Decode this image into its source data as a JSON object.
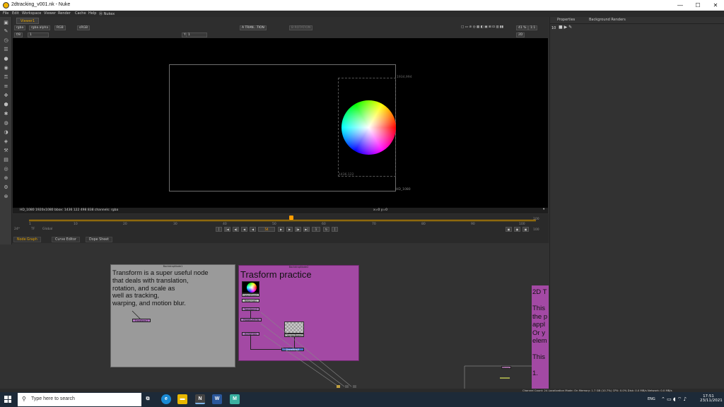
{
  "window": {
    "title": "2dtracking_v001.nk - Nuke",
    "min": "—",
    "max": "☐",
    "close": "✕"
  },
  "menu": [
    "File",
    "Edit",
    "Workspace",
    "Viewer",
    "Render",
    "Cache",
    "Help",
    "Ⓝ Nukex"
  ],
  "viewer": {
    "tab": "Viewer1",
    "channels": "rgba",
    "layer": "rgba.alpha",
    "display": "RGB",
    "lut": "sRGB",
    "input_a": "A  TRAN...TION",
    "input_b": "B  ROTATION",
    "frame_label": "f/8",
    "frame_value": "1",
    "y_label": "Y",
    "y_value": "1",
    "zoom": "41 %",
    "ratio": "1:1",
    "view_mode": "2D",
    "format_label": "HD_1080",
    "bbox_tl": "1934,994",
    "bbox_bl": "1436,122",
    "info": "HD_1080 1920x1080  bbox: 1436 122 498 838 channels: rgba",
    "coords": "x=0 y=0"
  },
  "timeline": {
    "ticks": [
      "1",
      "10",
      "20",
      "30",
      "40",
      "50",
      "60",
      "70",
      "80",
      "90",
      "100"
    ],
    "fps": "24*",
    "tf": "TF",
    "range_mode": "Global",
    "current_frame": "54",
    "in": "1",
    "out": "100",
    "end": "100"
  },
  "nodegraph_tabs": [
    "Node Graph",
    "Curve Editor",
    "Dope Sheet"
  ],
  "backdrops": [
    {
      "name": "BackdropNode1",
      "text": [
        "Transform is a super useful node",
        "that deals with translation,",
        "rotation, and scale as",
        "well as tracking,",
        "warping, and motion blur."
      ]
    },
    {
      "name": "BackdropNode2",
      "title": "Trasform practice"
    },
    {
      "name": "BackdropNode3",
      "lines": [
        "2D T",
        "",
        "This",
        "the p",
        "appl",
        "Or y",
        "elem",
        "",
        "This",
        "",
        "1."
      ]
    }
  ],
  "nodes": [
    "Transform1",
    "ColorWheel1",
    "Reformat1",
    "Transform2",
    "TRANSLATION",
    "ROTATION",
    "CheckerBoard1",
    "Transform3",
    "Merge1"
  ],
  "properties": {
    "tab1": "Properties",
    "tab2": "Background Renders",
    "count": "10"
  },
  "status": "Channel Count: 24  Localization Mode: On  Memory: 1.7 GB (10.7%)  CPU: 0.0%  Disk: 0.0 MB/s  Network: 0.0 MB/s",
  "taskbar": {
    "search": "Type here to search",
    "time": "17:51",
    "date": "23/11/2021",
    "lang": "ENG"
  },
  "colors": {
    "accent": "#ff9d00",
    "backdrop_grey": "#9a9a9a",
    "backdrop_purple": "#a349a4"
  }
}
